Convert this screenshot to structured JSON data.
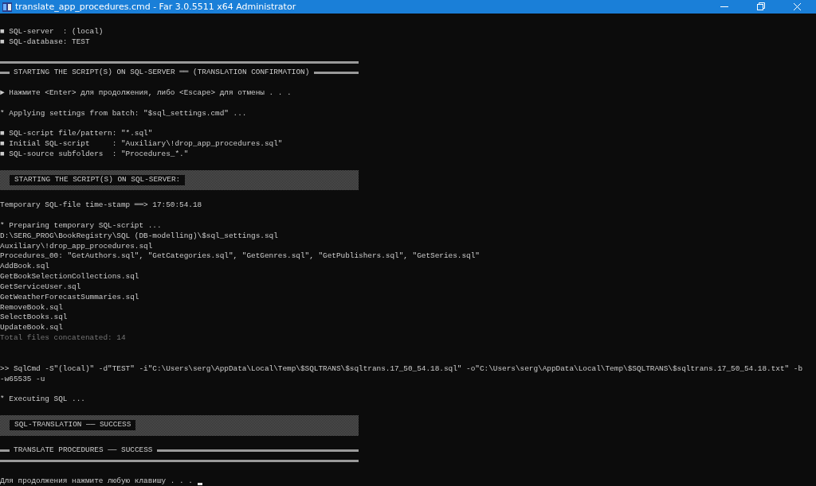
{
  "window": {
    "title": "translate_app_procedures.cmd - Far 3.0.5511 x64 Administrator"
  },
  "console": {
    "lines": [
      {
        "kind": "blank"
      },
      {
        "kind": "text",
        "text": "■ SQL-server  : (local)"
      },
      {
        "kind": "text",
        "text": "■ SQL-database: TEST"
      },
      {
        "kind": "blank"
      },
      {
        "kind": "rule"
      },
      {
        "kind": "heading",
        "text": "STARTING THE SCRIPT(S) ON SQL-SERVER ══ (TRANSLATION CONFIRMATION)"
      },
      {
        "kind": "blank"
      },
      {
        "kind": "text",
        "text": "► Нажмите <Enter> для продолжения, либо <Escape> для отмены . . ."
      },
      {
        "kind": "blank"
      },
      {
        "kind": "text",
        "text": "* Applying settings from batch: \"$sql_settings.cmd\" ..."
      },
      {
        "kind": "blank"
      },
      {
        "kind": "text",
        "text": "■ SQL-script file/pattern: \"*.sql\""
      },
      {
        "kind": "text",
        "text": "■ Initial SQL-script     : \"Auxiliary\\!drop_app_procedures.sql\""
      },
      {
        "kind": "text",
        "text": "■ SQL-source subfolders  : \"Procedures_*.\""
      },
      {
        "kind": "blank"
      },
      {
        "kind": "banner",
        "text": "STARTING THE SCRIPT(S) ON SQL-SERVER:"
      },
      {
        "kind": "blank"
      },
      {
        "kind": "text",
        "text": "Temporary SQL-file time-stamp ══> 17:50:54.18"
      },
      {
        "kind": "blank"
      },
      {
        "kind": "text",
        "text": "* Preparing temporary SQL-script ..."
      },
      {
        "kind": "text",
        "text": "D:\\SERG_PROG\\BookRegistry\\SQL (DB-modelling)\\$sql_settings.sql"
      },
      {
        "kind": "text",
        "text": "Auxiliary\\!drop_app_procedures.sql"
      },
      {
        "kind": "text",
        "text": "Procedures_00: \"GetAuthors.sql\", \"GetCategories.sql\", \"GetGenres.sql\", \"GetPublishers.sql\", \"GetSeries.sql\""
      },
      {
        "kind": "text",
        "text": "AddBook.sql"
      },
      {
        "kind": "text",
        "text": "GetBookSelectionCollections.sql"
      },
      {
        "kind": "text",
        "text": "GetServiceUser.sql"
      },
      {
        "kind": "text",
        "text": "GetWeatherForecastSummaries.sql"
      },
      {
        "kind": "text",
        "text": "RemoveBook.sql"
      },
      {
        "kind": "text",
        "text": "SelectBooks.sql"
      },
      {
        "kind": "text",
        "text": "UpdateBook.sql"
      },
      {
        "kind": "dim",
        "text": "Total files concatenated: 14"
      },
      {
        "kind": "blank"
      },
      {
        "kind": "blank"
      },
      {
        "kind": "text",
        "text": ">> SqlCmd -S\"(local)\" -d\"TEST\" -i\"C:\\Users\\serg\\AppData\\Local\\Temp\\$SQLTRANS\\$sqltrans.17_50_54.18.sql\" -o\"C:\\Users\\serg\\AppData\\Local\\Temp\\$SQLTRANS\\$sqltrans.17_50_54.18.txt\" -b"
      },
      {
        "kind": "text",
        "text": "-w65535 -u"
      },
      {
        "kind": "blank"
      },
      {
        "kind": "text",
        "text": "* Executing SQL ..."
      },
      {
        "kind": "blank"
      },
      {
        "kind": "banner",
        "text": "SQL-TRANSLATION ── SUCCESS"
      },
      {
        "kind": "blank"
      },
      {
        "kind": "heading",
        "text": "TRANSLATE PROCEDURES ── SUCCESS"
      },
      {
        "kind": "rule"
      },
      {
        "kind": "blank"
      },
      {
        "kind": "text",
        "text": "Для продолжения нажмите любую клавишу . . .",
        "cursor": true
      }
    ]
  }
}
